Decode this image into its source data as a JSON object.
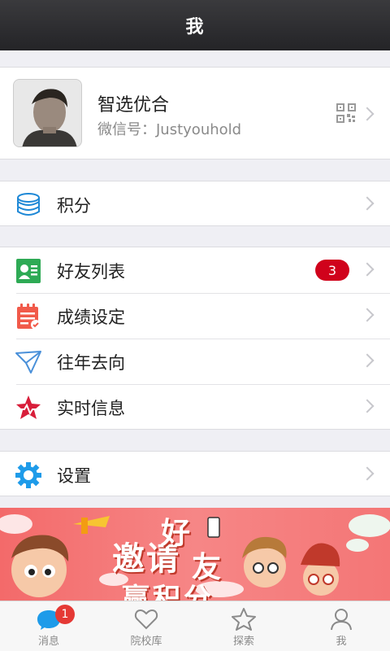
{
  "nav": {
    "title": "我"
  },
  "profile": {
    "name": "智选优合",
    "wechat_id": "微信号：Justyouhold"
  },
  "menu": {
    "points": "积分",
    "friends": "好友列表",
    "friends_badge": "3",
    "scores": "成绩设定",
    "history": "往年去向",
    "news": "实时信息",
    "settings": "设置"
  },
  "banner": {
    "line1": "邀请",
    "line2": "好",
    "line2b": "友",
    "line3": "赢积分"
  },
  "tabs": [
    {
      "label": "消息",
      "badge": "1"
    },
    {
      "label": "院校库"
    },
    {
      "label": "探索"
    },
    {
      "label": "我"
    }
  ],
  "colors": {
    "nav_bg": "#2b2b2e",
    "badge": "#d0021b",
    "banner_bg": "#f47676",
    "icon_blue": "#1e9be9"
  }
}
